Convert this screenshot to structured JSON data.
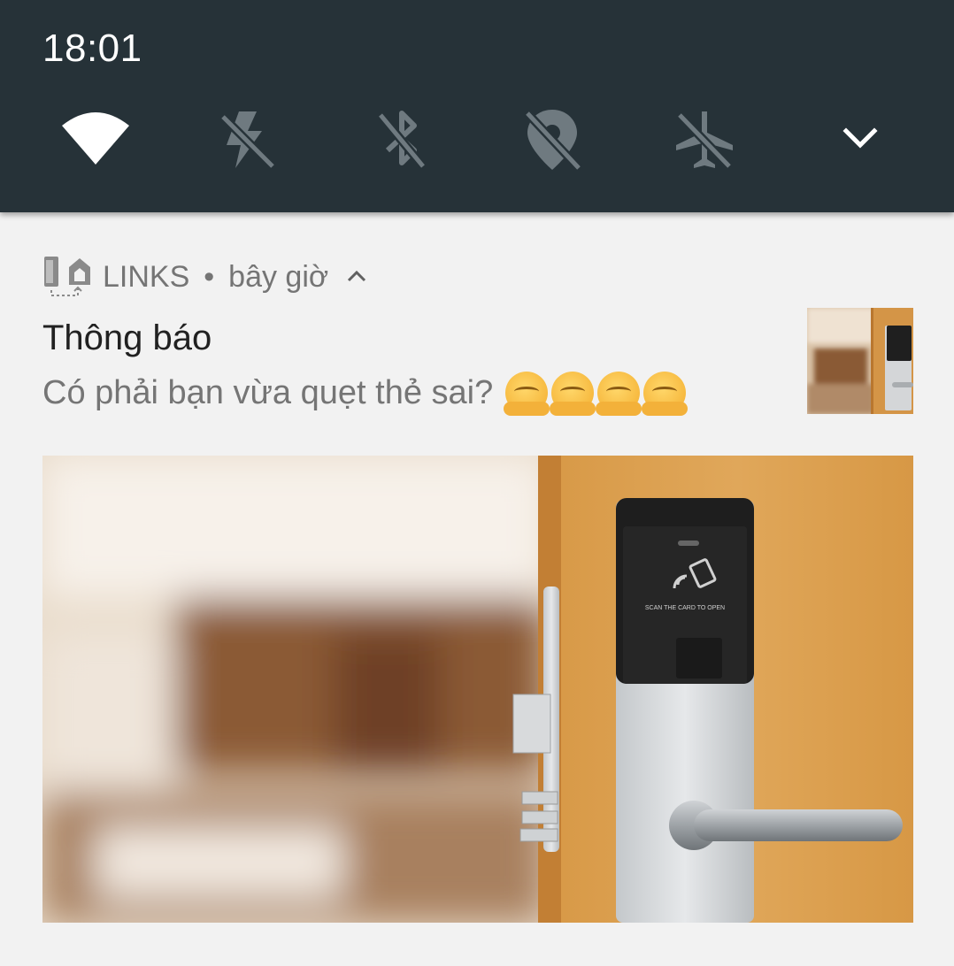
{
  "status_bar": {
    "time": "18:01",
    "quick_settings": [
      {
        "icon": "wifi-icon",
        "state": "on"
      },
      {
        "icon": "mobile-data-off-icon",
        "state": "off"
      },
      {
        "icon": "bluetooth-off-icon",
        "state": "off"
      },
      {
        "icon": "location-off-icon",
        "state": "off"
      },
      {
        "icon": "airplane-mode-off-icon",
        "state": "off"
      }
    ],
    "expand_icon": "chevron-down-icon",
    "colors": {
      "background": "#263238",
      "icon_on": "#ffffff",
      "icon_off": "#6f7a80"
    }
  },
  "notification": {
    "app_name": "LINKS",
    "separator": "•",
    "time": "bây giờ",
    "title": "Thông báo",
    "text": "Có phải bạn vừa quẹt thẻ sai?",
    "emoji_count": 4,
    "emoji": "hugging-face-emoji",
    "large_image": "hotel-door-card-lock-image",
    "thumbnail": "hotel-door-card-lock-thumbnail",
    "lock_panel_text": "SCAN THE CARD TO OPEN"
  }
}
